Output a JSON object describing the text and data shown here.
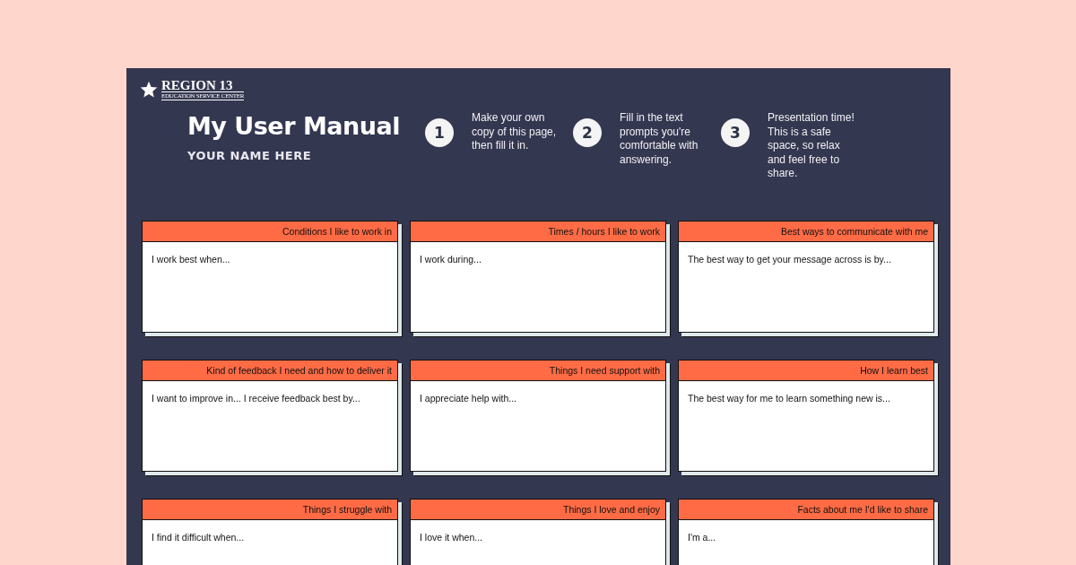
{
  "logo": {
    "name": "REGION 13",
    "tagline": "EDUCATION SERVICE CENTER"
  },
  "title": "My User Manual",
  "subtitle": "YOUR NAME HERE",
  "steps": [
    {
      "number": "1",
      "text": "Make your own copy of this page, then fill it in."
    },
    {
      "number": "2",
      "text": "Fill in the text prompts you're comfortable with answering."
    },
    {
      "number": "3",
      "text": "Presentation time! This is a safe space, so relax and feel free to share."
    }
  ],
  "cards": [
    {
      "heading": "Conditions I like to work in",
      "prompt": "I work best when..."
    },
    {
      "heading": "Times / hours I like to work",
      "prompt": "I work during..."
    },
    {
      "heading": "Best ways to communicate with me",
      "prompt": "The best way to get your message across is by..."
    },
    {
      "heading": "Kind of feedback I need and how to deliver it",
      "prompt": "I want to improve in... I receive feedback best by..."
    },
    {
      "heading": "Things I need support with",
      "prompt": "I appreciate help with..."
    },
    {
      "heading": "How I learn best",
      "prompt": "The best way for me to learn something new is..."
    },
    {
      "heading": "Things I struggle with",
      "prompt": "I find it difficult when..."
    },
    {
      "heading": "Things I love and enjoy",
      "prompt": "I love it when..."
    },
    {
      "heading": "Facts about me I'd like to share",
      "prompt": "I'm a..."
    }
  ]
}
